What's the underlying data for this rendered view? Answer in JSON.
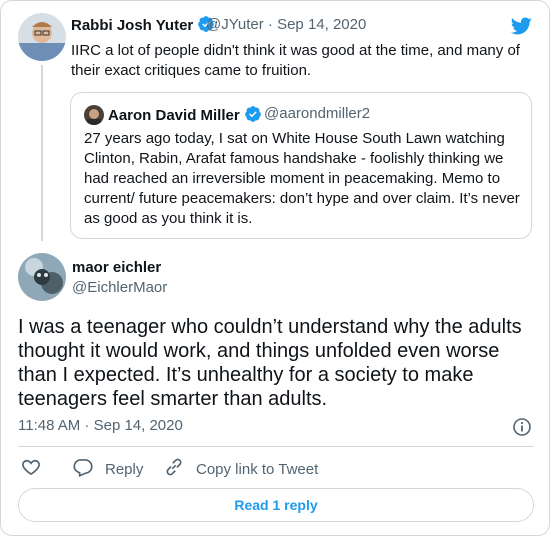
{
  "parent_tweet": {
    "name": "Rabbi Josh Yuter",
    "handle_date": "@JYuter · Sep 14, 2020",
    "text": "IIRC a lot of people didn't think it was good at the time, and many of their exact critiques came to fruition."
  },
  "quoted_tweet": {
    "name": "Aaron David Miller",
    "handle": "@aarondmiller2",
    "text": "27 years ago today, I sat on White House South Lawn watching Clinton, Rabin, Arafat famous handshake - foolishly thinking we had reached an irreversible moment in peacemaking. Memo to current/ future peacemakers: don’t hype and over claim. It’s never as good as you think it is."
  },
  "main_tweet": {
    "name": "maor eichler",
    "handle": "@EichlerMaor",
    "text": "I was a teenager who couldn’t understand why the adults thought it would work, and things unfolded even worse than I expected. It’s unhealthy for a society to make teenagers feel smarter than adults.",
    "timestamp": "11:48 AM · Sep 14, 2020"
  },
  "actions": {
    "reply_label": "Reply",
    "copy_label": "Copy link to Tweet",
    "read_replies_label": "Read 1 reply"
  },
  "colors": {
    "accent": "#1d9bf0",
    "secondary_text": "#536471",
    "border": "#cfd9de"
  },
  "icons": [
    "twitter-bird-icon",
    "verified-badge-icon",
    "info-icon",
    "heart-icon",
    "reply-icon",
    "link-icon"
  ]
}
